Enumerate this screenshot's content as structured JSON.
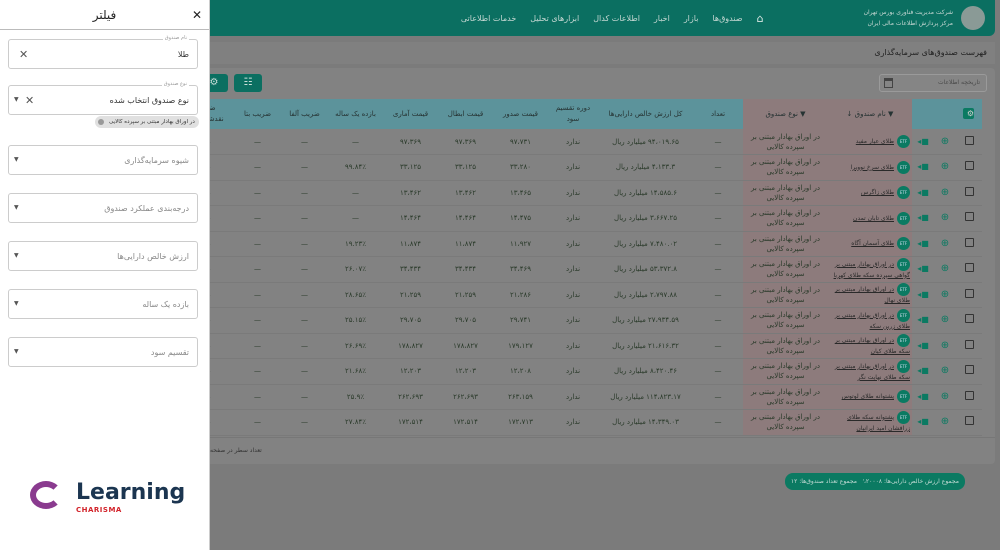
{
  "header": {
    "company_line1": "شرکت مدیریت فناوری بورس تهران",
    "company_line2": "مرکز پردازش اطلاعات مالی ایران",
    "nav": [
      "صندوق‌ها",
      "بازار",
      "اخبار",
      "اطلاعات کدال",
      "ابزارهای تحلیل",
      "خدمات اطلاعاتی"
    ]
  },
  "page_title": "فهرست صندوق‌های سرمایه‌گذاری",
  "date_placeholder": "تاریخچه اطلاعات",
  "table": {
    "headers": [
      "نام صندوق",
      "نوع صندوق",
      "تعداد",
      "کل ارزش خالص دارایی‌ها",
      "دوره تقسیم سود",
      "قیمت صدور",
      "قیمت ابطال",
      "قیمت آماری",
      "بازده یک ساله",
      "ضریب آلفا",
      "ضریب بتا",
      "ضامن نقدشوندگی"
    ],
    "rows": [
      [
        "طلای عیار مفید",
        "در اوراق بهادار مبتنی بر سپرده کالایی",
        "—",
        "۹۴،۰۱۹.۶۵ میلیارد ریال",
        "ندارد",
        "۹۷،۷۳۱",
        "۹۷،۳۶۹",
        "۹۷،۳۶۹",
        "—",
        "—",
        "—",
        "—"
      ],
      [
        "طلای سرخ نوویرا",
        "در اوراق بهادار مبتنی بر سپرده کالایی",
        "—",
        "۴،۱۳۳.۳ میلیارد ریال",
        "ندارد",
        "۳۳،۲۸۰",
        "۳۳،۱۲۵",
        "۳۳،۱۲۵",
        "۹۹.۸۴٪",
        "—",
        "—",
        "—"
      ],
      [
        "طلای زاگرس",
        "در اوراق بهادار مبتنی بر سپرده کالایی",
        "—",
        "۱۴،۵۸۵.۶ میلیارد ریال",
        "ندارد",
        "۱۳،۴۶۵",
        "۱۳،۴۶۲",
        "۱۳،۴۶۲",
        "—",
        "—",
        "—",
        "—"
      ],
      [
        "طلای تابان تمدن",
        "در اوراق بهادار مبتنی بر سپرده کالایی",
        "—",
        "۳،۶۶۷.۲۵ میلیارد ریال",
        "ندارد",
        "۱۴،۴۷۵",
        "۱۴،۴۶۴",
        "۱۴،۴۶۴",
        "—",
        "—",
        "—",
        "—"
      ],
      [
        "طلای آسمان آگاه",
        "در اوراق بهادار مبتنی بر سپرده کالایی",
        "—",
        "۷،۴۸۰.۰۲ میلیارد ریال",
        "ندارد",
        "۱۱،۹۲۷",
        "۱۱،۸۷۴",
        "۱۱،۸۷۴",
        "۱۹.۲۳٪",
        "—",
        "—",
        "—"
      ],
      [
        "در اوراق بهادار مبتنی بر گواهی سپرده سکه طلای کهربا",
        "در اوراق بهادار مبتنی بر سپرده کالایی",
        "—",
        "۵۳،۳۷۲.۸ میلیارد ریال",
        "ندارد",
        "۳۴،۴۶۹",
        "۳۴،۴۳۴",
        "۳۴،۴۳۴",
        "۲۶.۰۷٪",
        "—",
        "—",
        "—"
      ],
      [
        "در اوراق بهادار مبتنی بر طلای نهال",
        "در اوراق بهادار مبتنی بر سپرده کالایی",
        "—",
        "۲،۷۹۷.۸۸ میلیارد ریال",
        "ندارد",
        "۲۱،۲۸۶",
        "۲۱،۲۵۹",
        "۲۱،۲۵۹",
        "۲۸.۶۵٪",
        "—",
        "—",
        "—"
      ],
      [
        "در اوراق بهادار مبتنی بر طلای زرین سکه",
        "در اوراق بهادار مبتنی بر سپرده کالایی",
        "—",
        "۲۷،۹۳۴.۵۹ میلیارد ریال",
        "ندارد",
        "۲۹،۷۴۱",
        "۲۹،۷۰۵",
        "۲۹،۷۰۵",
        "۲۵.۱۵٪",
        "—",
        "—",
        "—"
      ],
      [
        "در اوراق بهادار مبتنی بر سکه طلای کیان",
        "در اوراق بهادار مبتنی بر سپرده کالایی",
        "—",
        "۲۱،۶۱۶.۳۲ میلیارد ریال",
        "ندارد",
        "۱۷۹،۱۲۷",
        "۱۷۸،۸۲۷",
        "۱۷۸،۸۲۷",
        "۲۶.۶۹٪",
        "—",
        "—",
        "—"
      ],
      [
        "در اوراق بهادار مبتنی بر سکه طلای نهایت نگر",
        "در اوراق بهادار مبتنی بر سپرده کالایی",
        "—",
        "۸،۴۲۰.۴۶ میلیارد ریال",
        "ندارد",
        "۱۲،۲۰۸",
        "۱۲،۲۰۳",
        "۱۲،۲۰۳",
        "۲۱.۶۸٪",
        "—",
        "—",
        "—"
      ],
      [
        "پشتوانه طلای لوتوس",
        "در اوراق بهادار مبتنی بر سپرده کالایی",
        "—",
        "۱۱۴،۸۲۳.۱۷ میلیارد ریال",
        "ندارد",
        "۲۶۳،۱۵۹",
        "۲۶۲،۶۹۳",
        "۲۶۲،۶۹۳",
        "۲۵.۹٪",
        "—",
        "—",
        "—"
      ],
      [
        "پشتوانه سکه طلای زرافشان امید ایرانیان",
        "در اوراق بهادار مبتنی بر سپرده کالایی",
        "—",
        "۱۴،۳۴۹.۰۳ میلیارد ریال",
        "ندارد",
        "۱۷۲،۷۱۳",
        "۱۷۲،۵۱۴",
        "۱۷۲،۵۱۴",
        "۲۷.۸۴٪",
        "—",
        "—",
        "—"
      ]
    ],
    "etf_badge": "ETF",
    "rows_per_page_label": "تعداد سطر در صفحه"
  },
  "summary": {
    "total_nav": "مجموع ارزش خالص دارایی‌ها: ۳۶۷،۲۰۰۰۸",
    "total_count": "مجموع تعداد صندوق‌ها: ۱۲"
  },
  "filter": {
    "title": "فیلتر",
    "fund_name_label": "نام صندوق",
    "fund_name_value": "طلا",
    "fund_type_label": "نوع صندوق",
    "fund_type_value": "نوع صندوق انتخاب شده",
    "fund_type_chip": "در اوراق بهادار مبتنی بر سپرده کالایی",
    "selects": [
      "شیوه سرمایه‌گذاری",
      "درجه‌بندی عملکرد صندوق",
      "ارزش خالص دارایی‌ها",
      "بازده یک ساله",
      "تقسیم سود"
    ]
  },
  "brand": {
    "name": "Learning",
    "sub": "CHARISMA"
  },
  "colors": {
    "header": "#0b6f61",
    "accent": "#0b7a62",
    "table_header": "#5c939b",
    "highlight_column": "#8d7b7c"
  }
}
